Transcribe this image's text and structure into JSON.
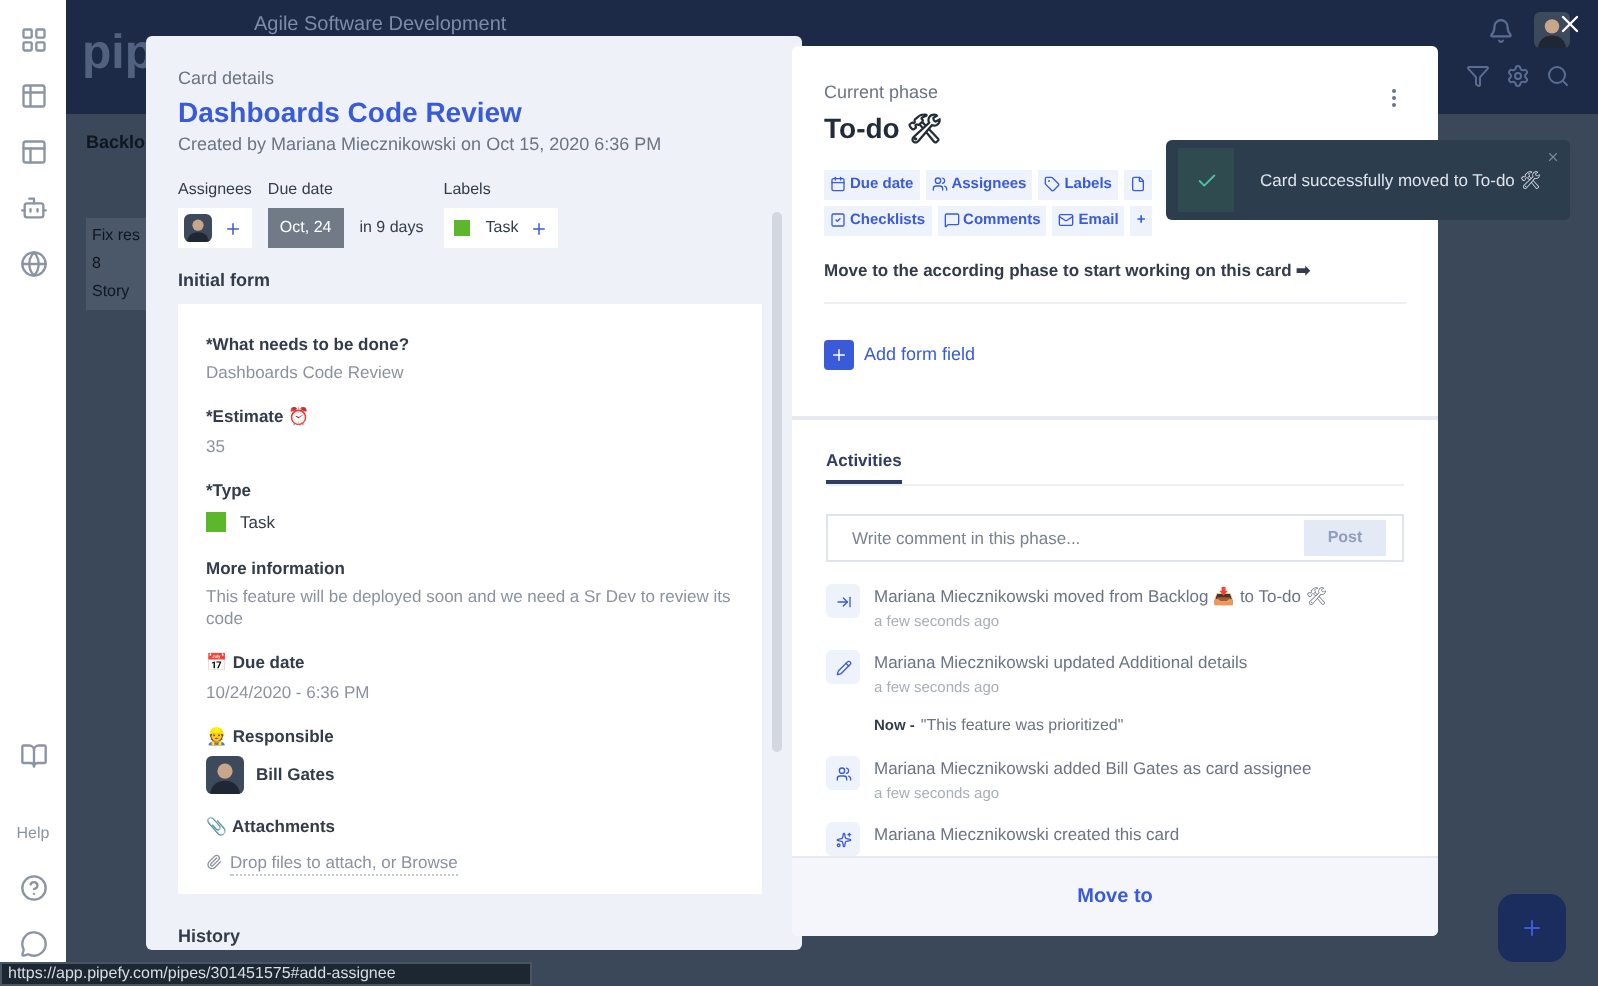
{
  "app_header": {
    "logo": "pip",
    "title": "Agile Software Development"
  },
  "board": {
    "phase_title": "Backlo",
    "card": {
      "title": "Fix res",
      "number": "8",
      "type": "Story"
    }
  },
  "sidebar": {
    "help": "Help"
  },
  "card_details": {
    "caption": "Card details",
    "title": "Dashboards Code Review",
    "created_by": "Created by Mariana Miecznikowski on Oct 15, 2020 6:36 PM",
    "assignees_label": "Assignees",
    "due_date_label": "Due date",
    "due_date": "Oct, 24",
    "due_in": "in 9 days",
    "labels_label": "Labels",
    "labels": [
      {
        "name": "Task",
        "color": "#5cb82a"
      }
    ],
    "initial_form": {
      "title": "Initial form",
      "fields": [
        {
          "kind": "text",
          "label": "*What needs to be done?",
          "value": "Dashboards Code Review"
        },
        {
          "kind": "text",
          "label": "*Estimate ⏰",
          "value": "35"
        },
        {
          "kind": "label",
          "label": "*Type",
          "value": "Task",
          "color": "#5cb82a"
        },
        {
          "kind": "text",
          "label": "More information",
          "value": "This feature will be deployed soon and we need a Sr Dev to review its code"
        },
        {
          "kind": "text",
          "label": "📅 Due date",
          "value": "10/24/2020 - 6:36 PM"
        },
        {
          "kind": "person",
          "label": "👷 Responsible",
          "value": "Bill Gates"
        },
        {
          "kind": "attachment",
          "label": "📎 Attachments",
          "value": "Drop files to attach, or Browse"
        }
      ]
    },
    "history": "History"
  },
  "phase": {
    "caption": "Current phase",
    "name": "To-do 🛠",
    "actions": [
      {
        "kind": "calendar",
        "label": "Due date"
      },
      {
        "kind": "users",
        "label": "Assignees"
      },
      {
        "kind": "tag",
        "label": "Labels"
      },
      {
        "kind": "file"
      },
      {
        "kind": "checklist",
        "label": "Checklists"
      },
      {
        "kind": "comment",
        "label": "Comments"
      },
      {
        "kind": "email",
        "label": "Email"
      },
      {
        "kind": "more",
        "label": "+"
      }
    ],
    "hint": "Move to the according phase to start working on this card ➡",
    "add_field": "Add form field",
    "tabs": [
      {
        "label": "Activities",
        "selected": true
      }
    ],
    "comment": {
      "placeholder": "Write comment in this phase...",
      "post": "Post",
      "post_disabled": true
    },
    "activities": [
      {
        "kind": "move",
        "text": "Mariana Miecznikowski moved from Backlog 📥 to To-do 🛠",
        "time": "a few seconds ago"
      },
      {
        "kind": "edit",
        "text": "Mariana Miecznikowski updated Additional details",
        "time": "a few seconds ago",
        "detail_label": "Now -",
        "detail": "\"This feature was prioritized\""
      },
      {
        "kind": "assign",
        "text": "Mariana Miecznikowski added Bill Gates as card assignee",
        "time": "a few seconds ago"
      },
      {
        "kind": "create",
        "text": "Mariana Miecznikowski created this card"
      }
    ],
    "move_to": "Move to"
  },
  "toast": {
    "message": "Card successfully moved to To-do 🛠"
  },
  "status_bar": {
    "url": "https://app.pipefy.com/pipes/301451575#add-assignee"
  }
}
